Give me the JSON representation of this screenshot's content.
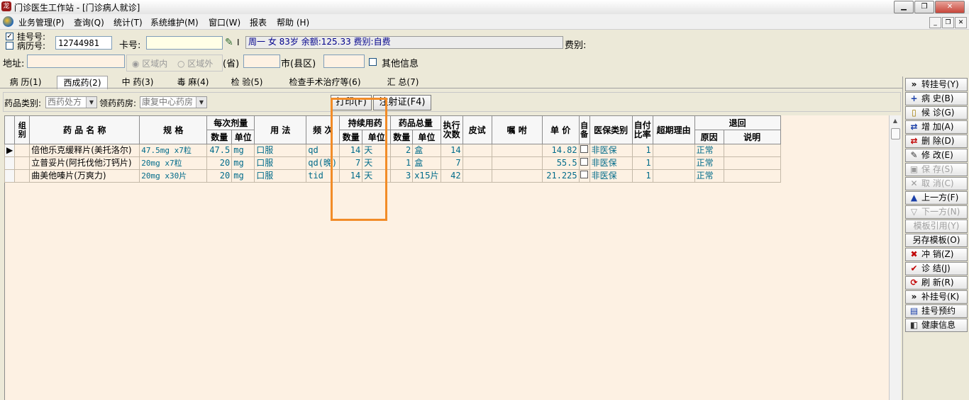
{
  "window": {
    "title": "门诊医生工作站 - [门诊病人就诊]",
    "logo": "龙",
    "buttons": [
      "▁",
      "❐",
      "✕"
    ],
    "mdi_buttons": [
      "_",
      "❐",
      "✕"
    ]
  },
  "menu": [
    "业务管理(P)",
    "查询(Q)",
    "统计(T)",
    "系统维护(M)",
    "窗口(W)",
    "报表",
    "帮助 (H)"
  ],
  "patient": {
    "reg_no_label": "挂号号:",
    "record_no_label": "病历号:",
    "record_no_value": "12744981",
    "card_no_label": "卡号:",
    "card_no_value": "",
    "card_icon_suffix": "I",
    "info_text": "周一  女  83岁  余额:125.33  费别:自费",
    "fee_label": "费别:",
    "address_label": "地址:",
    "region_in": "区域内",
    "region_out": "区域外",
    "province_label": "(省)",
    "city_label": "市(县区)",
    "other_info_label": "其他信息"
  },
  "tabs": [
    "病 历(1)",
    "西成药(2)",
    "中 药(3)",
    "毒 麻(4)",
    "检 验(5)",
    "检查手术治疗等(6)",
    "汇 总(7)"
  ],
  "active_tab": "西成药(2)",
  "filters": {
    "drug_category_label": "药品类别:",
    "drug_category_value": "西药处方",
    "pharmacy_label": "领药药房:",
    "pharmacy_value": "康复中心药房",
    "print_button": "打印(F)",
    "injection_button": "注射证(F4)"
  },
  "grid": {
    "headers": {
      "group": "组别",
      "name": "药 品 名 称",
      "spec": "规     格",
      "per_dose": "每次剂量",
      "qty": "数量",
      "unit": "单位",
      "usage": "用  法",
      "freq": "频  次",
      "continuous": "持续用药",
      "total": "药品总量",
      "exec_count": "执行次数",
      "skin_test": "皮试",
      "instruction": "嘱  咐",
      "price": "单 价",
      "self_prepare": "自备",
      "insurance_type": "医保类别",
      "self_pay_ratio": "自付比率",
      "overlimit_reason": "超期理由",
      "return": "退回",
      "reason": "原因",
      "remark": "说明"
    },
    "rows": [
      {
        "name": "倍他乐克缓释片(美托洛尔)",
        "spec": "47.5mg x7粒",
        "dose_qty": "47.5",
        "dose_unit": "mg",
        "usage": "口服",
        "freq": "qd",
        "cont_qty": "14",
        "cont_unit": "天",
        "total_qty": "2",
        "total_unit": "盒",
        "exec": "14",
        "skin": "",
        "instr": "",
        "price": "14.82",
        "insurance": "非医保",
        "ratio": "1",
        "overlimit": "",
        "ret_reason": "正常",
        "ret_remark": ""
      },
      {
        "name": "立普妥片(阿托伐他汀钙片)",
        "spec": "20mg x7粒",
        "dose_qty": "20",
        "dose_unit": "mg",
        "usage": "口服",
        "freq": "qd(晚)",
        "cont_qty": "7",
        "cont_unit": "天",
        "total_qty": "1",
        "total_unit": "盒",
        "exec": "7",
        "skin": "",
        "instr": "",
        "price": "55.5",
        "insurance": "非医保",
        "ratio": "1",
        "overlimit": "",
        "ret_reason": "正常",
        "ret_remark": ""
      },
      {
        "name": "曲美他嗪片(万爽力)",
        "spec": "20mg x30片",
        "dose_qty": "20",
        "dose_unit": "mg",
        "usage": "口服",
        "freq": "tid",
        "cont_qty": "14",
        "cont_unit": "天",
        "total_qty": "3",
        "total_unit": "x15片",
        "exec": "42",
        "skin": "",
        "instr": "",
        "price": "21.225",
        "insurance": "非医保",
        "ratio": "1",
        "overlimit": "",
        "ret_reason": "正常",
        "ret_remark": ""
      }
    ]
  },
  "side_buttons": [
    {
      "label": "转挂号(Y)",
      "icon": "»",
      "icon_color": "#000000",
      "disabled": false
    },
    {
      "label": "病  史(B)",
      "icon": "+",
      "icon_color": "#1a3fa8",
      "disabled": false
    },
    {
      "label": "候  诊(G)",
      "icon": "▯",
      "icon_color": "#a07a00",
      "disabled": false
    },
    {
      "label": "增  加(A)",
      "icon": "⇄",
      "icon_color": "#1a3fa8",
      "disabled": false
    },
    {
      "label": "删  除(D)",
      "icon": "⇄",
      "icon_color": "#c00000",
      "disabled": false
    },
    {
      "label": "修  改(E)",
      "icon": "✎",
      "icon_color": "#333333",
      "disabled": false
    },
    {
      "label": "保  存(S)",
      "icon": "▣",
      "icon_color": "#9a9a9a",
      "disabled": true
    },
    {
      "label": "取  消(C)",
      "icon": "✕",
      "icon_color": "#9a9a9a",
      "disabled": true
    },
    {
      "label": "上一方(F)",
      "icon": "▲",
      "icon_color": "#1a3fa8",
      "disabled": false
    },
    {
      "label": "下一方(N)",
      "icon": "▽",
      "icon_color": "#9a9a9a",
      "disabled": true
    },
    {
      "label": "模板引用(Y)",
      "icon": "",
      "icon_color": "#9a9a9a",
      "disabled": true
    },
    {
      "label": "另存模板(O)",
      "icon": "",
      "icon_color": "#000000",
      "disabled": false
    },
    {
      "label": "冲  销(Z)",
      "icon": "✖",
      "icon_color": "#c00000",
      "disabled": false
    },
    {
      "label": "诊  结(J)",
      "icon": "✔",
      "icon_color": "#c00000",
      "disabled": false
    },
    {
      "label": "刷  新(R)",
      "icon": "⟳",
      "icon_color": "#c00000",
      "disabled": false
    },
    {
      "label": "补挂号(K)",
      "icon": "»",
      "icon_color": "#000000",
      "disabled": false
    },
    {
      "label": "挂号预约",
      "icon": "▤",
      "icon_color": "#1a3fa8",
      "disabled": false
    },
    {
      "label": "健康信息",
      "icon": "◧",
      "icon_color": "#333333",
      "disabled": false
    }
  ],
  "colors": {
    "grid_bg": "#fdf1e3",
    "highlight": "#f28c28",
    "text_cyan": "#006b8a",
    "info_text": "#00008b"
  }
}
